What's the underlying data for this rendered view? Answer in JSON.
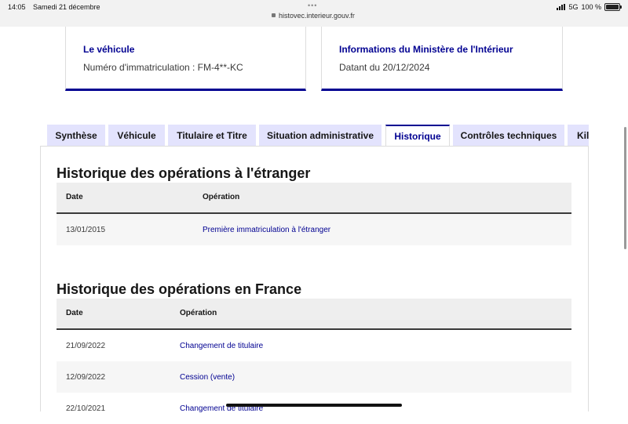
{
  "status_bar": {
    "time": "14:05",
    "date": "Samedi 21 décembre",
    "url": "histovec.interieur.gouv.fr",
    "network": "5G",
    "battery": "100 %"
  },
  "cards": [
    {
      "title": "Le véhicule",
      "text": "Numéro d'immatriculation : FM-4**-KC"
    },
    {
      "title": "Informations du Ministère de l'Intérieur",
      "text": "Datant du 20/12/2024"
    }
  ],
  "tabs": [
    {
      "label": "Synthèse"
    },
    {
      "label": "Véhicule"
    },
    {
      "label": "Titulaire et Titre"
    },
    {
      "label": "Situation administrative"
    },
    {
      "label": "Historique"
    },
    {
      "label": "Contrôles techniques"
    },
    {
      "label": "Kilométrage"
    }
  ],
  "abroad": {
    "title": "Historique des opérations à l'étranger",
    "columns": [
      "Date",
      "Opération"
    ],
    "rows": [
      {
        "date": "13/01/2015",
        "operation": "Première immatriculation à l'étranger"
      }
    ]
  },
  "france": {
    "title": "Historique des opérations en France",
    "columns": [
      "Date",
      "Opération"
    ],
    "rows": [
      {
        "date": "21/09/2022",
        "operation": "Changement de titulaire"
      },
      {
        "date": "12/09/2022",
        "operation": "Cession (vente)"
      },
      {
        "date": "22/10/2021",
        "operation": "Changement de titulaire"
      }
    ]
  },
  "colors": {
    "accent": "#000091",
    "tab_background": "#e3e3fd",
    "row_striped": "#f6f6f6"
  }
}
